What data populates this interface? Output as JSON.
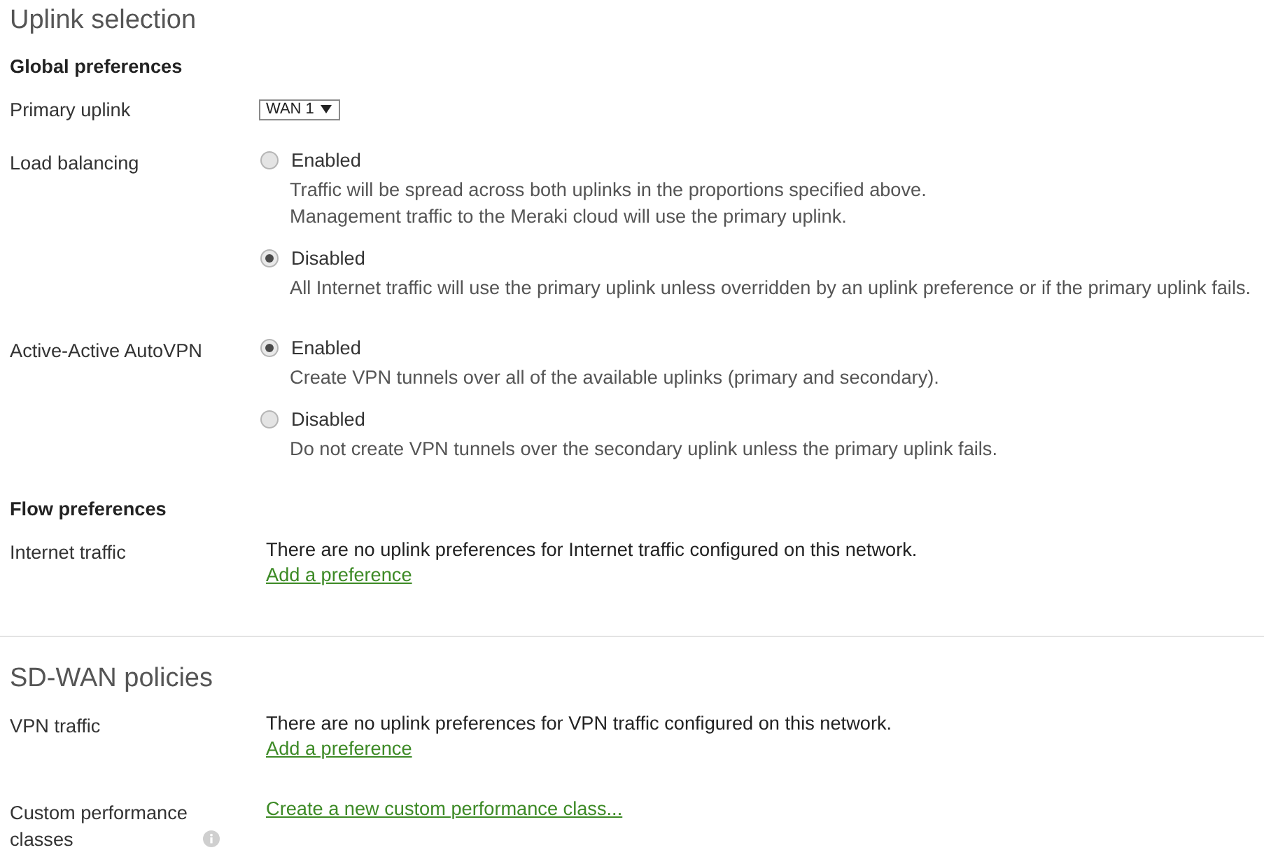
{
  "sections": [
    {
      "title": "Uplink selection",
      "groups": [
        {
          "heading": "Global preferences",
          "rows": [
            {
              "kind": "select",
              "label": "Primary uplink",
              "value": "WAN 1"
            },
            {
              "kind": "radio",
              "label": "Load balancing",
              "options": [
                {
                  "label": "Enabled",
                  "selected": false,
                  "description": [
                    "Traffic will be spread across both uplinks in the proportions specified above.",
                    "Management traffic to the Meraki cloud will use the primary uplink."
                  ]
                },
                {
                  "label": "Disabled",
                  "selected": true,
                  "description": [
                    "All Internet traffic will use the primary uplink unless overridden by an uplink preference or if the primary uplink fails."
                  ]
                }
              ]
            },
            {
              "kind": "radio",
              "label": "Active-Active AutoVPN",
              "options": [
                {
                  "label": "Enabled",
                  "selected": true,
                  "description": [
                    "Create VPN tunnels over all of the available uplinks (primary and secondary)."
                  ]
                },
                {
                  "label": "Disabled",
                  "selected": false,
                  "description": [
                    "Do not create VPN tunnels over the secondary uplink unless the primary uplink fails."
                  ]
                }
              ]
            }
          ]
        },
        {
          "heading": "Flow preferences",
          "rows": [
            {
              "kind": "notice",
              "label": "Internet traffic",
              "message": "There are no uplink preferences for Internet traffic configured on this network.",
              "link": "Add a preference"
            }
          ]
        }
      ]
    },
    {
      "title": "SD-WAN policies",
      "groups": [
        {
          "rows": [
            {
              "kind": "notice",
              "label": "VPN traffic",
              "message": "There are no uplink preferences for VPN traffic configured on this network.",
              "link": "Add a preference"
            },
            {
              "kind": "notice",
              "label": "Custom performance classes",
              "info": true,
              "link": "Create a new custom performance class..."
            }
          ]
        }
      ]
    }
  ]
}
